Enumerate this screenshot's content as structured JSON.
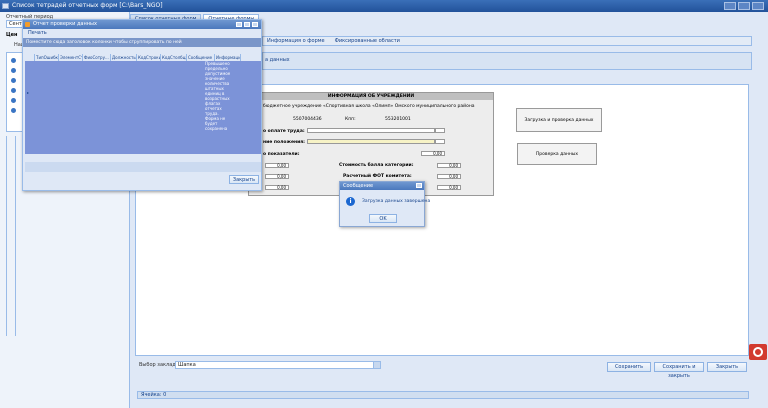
{
  "window": {
    "title": "Список тетрадей отчетных форм    [C:\\Bars_NGO]"
  },
  "left_panel": {
    "period_label": "Отчетный период",
    "period_value": "Сентябрь",
    "list_header": "Цен",
    "col_header": "Наи"
  },
  "tabs": [
    {
      "label": "Список отчетных форм"
    },
    {
      "label": "Отчетные формы"
    }
  ],
  "toolbar": {
    "items": [
      "Информация о форме",
      "Фиксированные области"
    ]
  },
  "subbar": {
    "text": "а данных"
  },
  "form": {
    "title": "ИНФОРМАЦИЯ ОБ УЧРЕЖДЕНИИ",
    "org_line": "бюджетное учреждение «Спортивная школа «Олимп» Омского муниципального района",
    "inn_value": "5507004436",
    "kpp_label": "Кпп:",
    "kpp_value": "553201001",
    "row1_label": "о оплате труда:",
    "row2_label": "ние положения:",
    "row3_label": "о показатели:",
    "row3_value": "0,00",
    "row4_left_value": "0,00",
    "row4_label": "Стоимость балла категории:",
    "row4_value": "0,00",
    "row5_left_value": "0,00",
    "row5_label": "Расчетный ФОТ комитета:",
    "row5_value": "0,00",
    "row6_left_value": "0,00",
    "row6_value": "0,00"
  },
  "side_buttons": {
    "load_check": "Загрузка и проверка данных",
    "check": "Проверка данных"
  },
  "bottom": {
    "tab_select_label": "Выбор закладки",
    "tab_select_value": "Шапка",
    "save": "Сохранить",
    "save_close": "Сохранить и закрыть",
    "close": "Закрыть",
    "status": "Ячейка: 0"
  },
  "report_window": {
    "title": "Отчет проверки данных",
    "print": "Печать",
    "hint": "Поместите сюда заголовок колонки чтобы сгруппировать по ней",
    "columns": [
      "ТипОшибки",
      "ЭлементСт...",
      "ФиоСотру...",
      "ДолжностьС...",
      "КодСтроки",
      "КодСтолбца",
      "Сообщение",
      "Информация"
    ],
    "message": "Превышено предельно допустимое значение количества штатных единиц в возрастных флагах отчетах труда. Форма не будет сохранена",
    "close": "Закрыть"
  },
  "message_box": {
    "title": "Сообщение",
    "text": "Загрузка данных завершена",
    "ok": "OK"
  },
  "icons": [
    "app-icon",
    "info-icon",
    "report-icon",
    "red-corner-icon"
  ],
  "colors": {
    "accent": "#22529a",
    "grid": "#7c93d8",
    "panel": "#dfe8f6"
  }
}
